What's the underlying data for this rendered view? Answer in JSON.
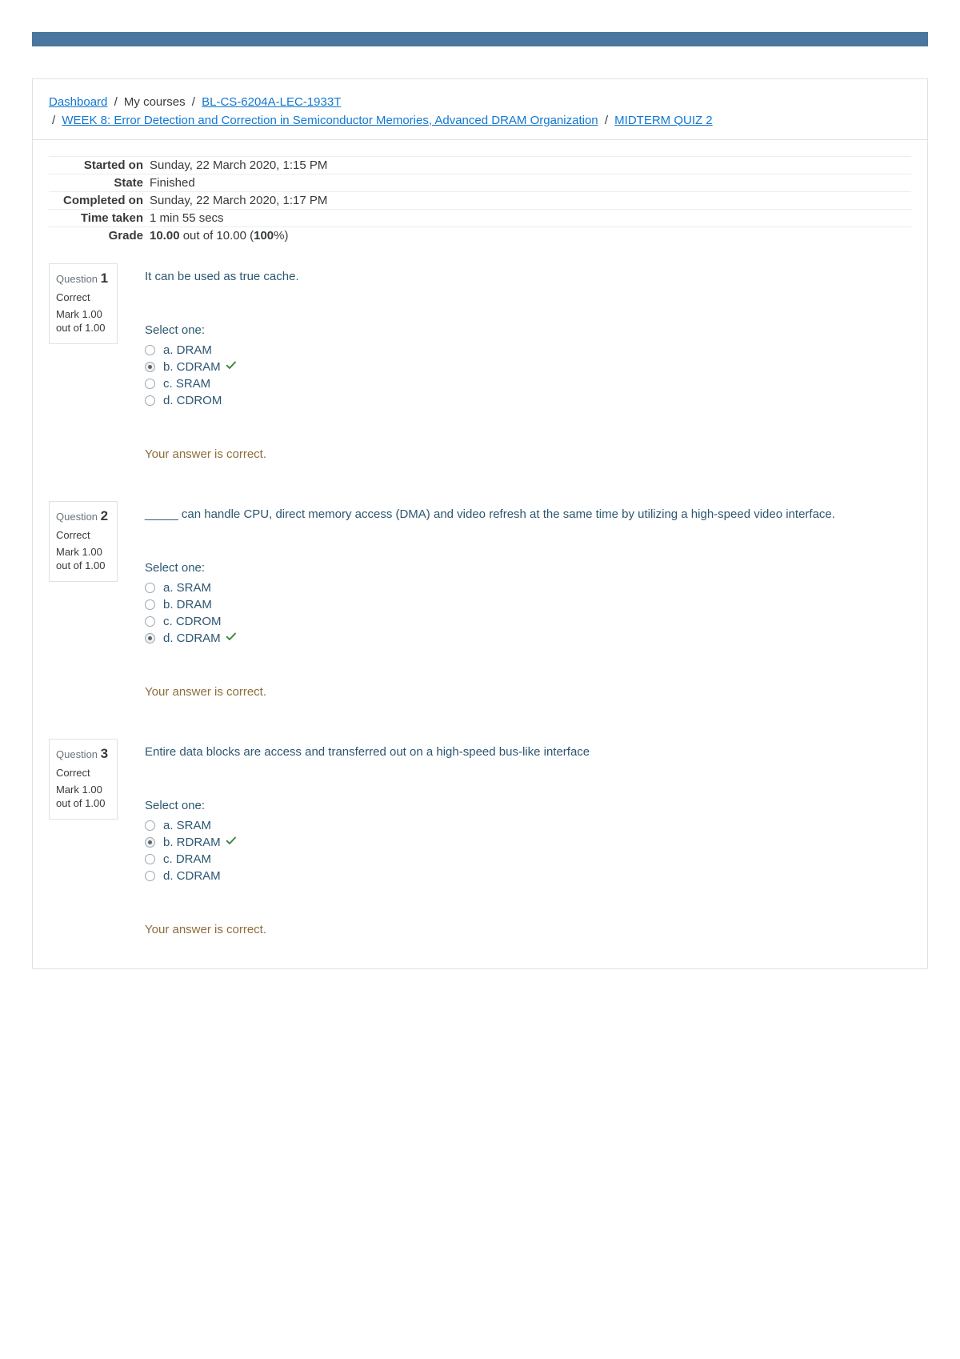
{
  "breadcrumb": {
    "dashboard": "Dashboard",
    "my_courses": "My courses",
    "course": "BL-CS-6204A-LEC-1933T",
    "week": "WEEK 8: Error Detection and Correction in Semiconductor Memories, Advanced DRAM Organization",
    "quiz": "MIDTERM QUIZ 2"
  },
  "summary": {
    "started_label": "Started on",
    "started_value": "Sunday, 22 March 2020, 1:15 PM",
    "state_label": "State",
    "state_value": "Finished",
    "completed_label": "Completed on",
    "completed_value": "Sunday, 22 March 2020, 1:17 PM",
    "time_label": "Time taken",
    "time_value": "1 min 55 secs",
    "grade_label": "Grade",
    "grade_score": "10.00",
    "grade_middle": " out of 10.00 (",
    "grade_pct": "100",
    "grade_end": "%)"
  },
  "questions": [
    {
      "label": "Question",
      "num": "1",
      "state": "Correct",
      "mark": "Mark 1.00 out of 1.00",
      "text": "It can be used as true cache.",
      "select_one": "Select one:",
      "answers": [
        {
          "label": "a. DRAM",
          "checked": false,
          "correct": false
        },
        {
          "label": "b. CDRAM",
          "checked": true,
          "correct": true
        },
        {
          "label": "c. SRAM",
          "checked": false,
          "correct": false
        },
        {
          "label": "d. CDROM",
          "checked": false,
          "correct": false
        }
      ],
      "feedback": "Your answer is correct."
    },
    {
      "label": "Question",
      "num": "2",
      "state": "Correct",
      "mark": "Mark 1.00 out of 1.00",
      "text": "_____ can handle CPU, direct memory access (DMA) and video refresh at the same time by utilizing a high-speed video interface.",
      "select_one": "Select one:",
      "answers": [
        {
          "label": "a. SRAM",
          "checked": false,
          "correct": false
        },
        {
          "label": "b. DRAM",
          "checked": false,
          "correct": false
        },
        {
          "label": "c. CDROM",
          "checked": false,
          "correct": false
        },
        {
          "label": "d. CDRAM",
          "checked": true,
          "correct": true
        }
      ],
      "feedback": "Your answer is correct."
    },
    {
      "label": "Question",
      "num": "3",
      "state": "Correct",
      "mark": "Mark 1.00 out of 1.00",
      "text": "Entire data blocks are access and transferred out on a high-speed bus-like interface",
      "select_one": "Select one:",
      "answers": [
        {
          "label": "a. SRAM",
          "checked": false,
          "correct": false
        },
        {
          "label": "b. RDRAM",
          "checked": true,
          "correct": true
        },
        {
          "label": "c. DRAM",
          "checked": false,
          "correct": false
        },
        {
          "label": "d. CDRAM",
          "checked": false,
          "correct": false
        }
      ],
      "feedback": "Your answer is correct."
    }
  ]
}
